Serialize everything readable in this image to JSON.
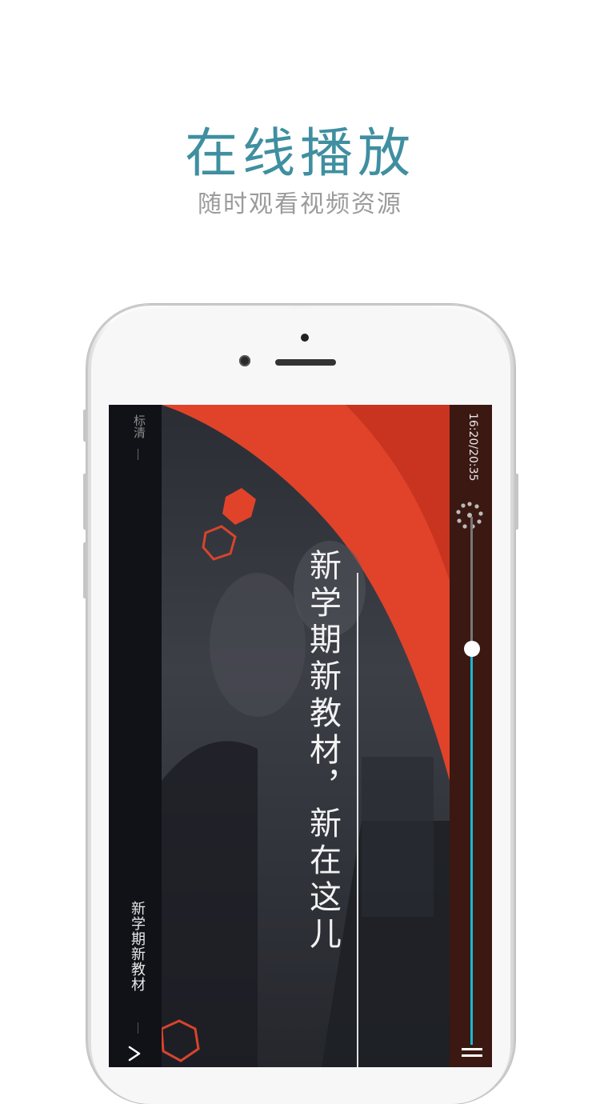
{
  "promo": {
    "headline": "在线播放",
    "subline": "随时观看视频资源"
  },
  "player": {
    "quality_label": "标清",
    "video_title": "新学期新教材",
    "slogan": "新学期新教材，新在这儿",
    "time_label": "16:20/20:35",
    "progress_fraction": 0.75,
    "accent_color": "#19b8d3",
    "brand_red": "#e0432a",
    "icons": {
      "back": "chevron-down-icon",
      "menu": "menu-icon",
      "loading": "loading-icon"
    }
  }
}
